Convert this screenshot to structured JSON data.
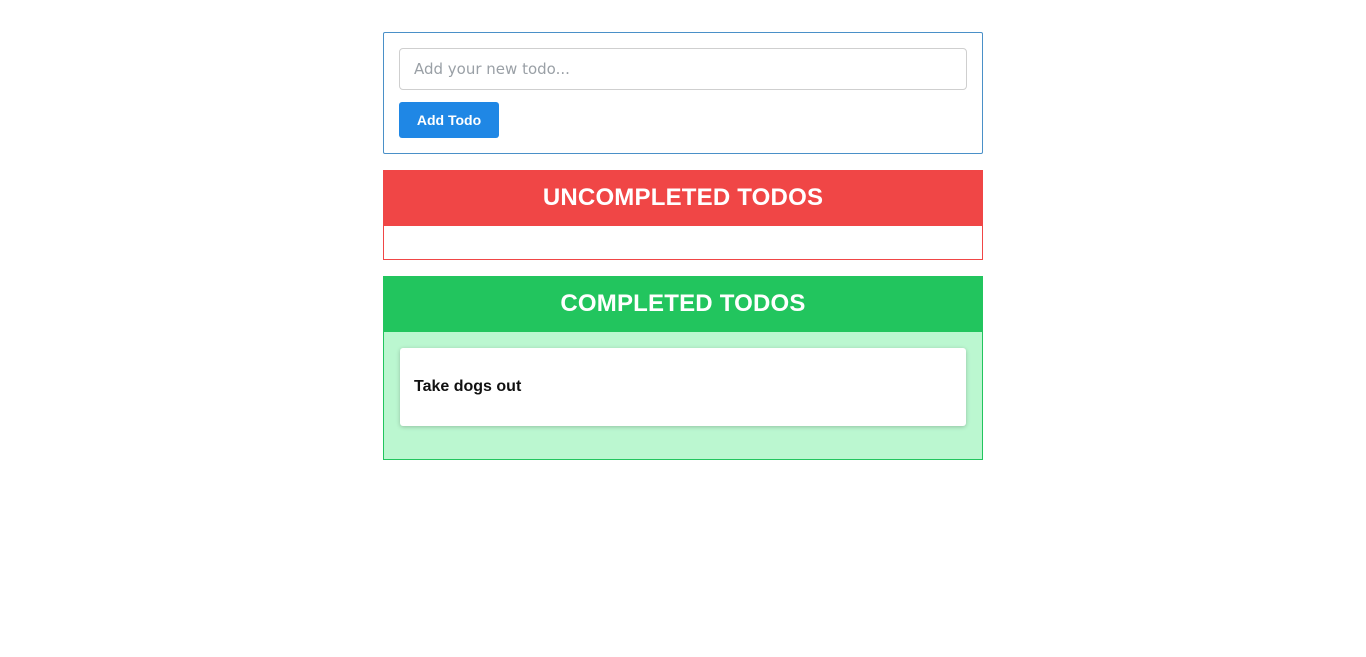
{
  "form": {
    "input_value": "",
    "input_placeholder": "Add your new todo...",
    "add_button_label": "Add Todo"
  },
  "uncompleted": {
    "title": "UNCOMPLETED TODOS",
    "items": []
  },
  "completed": {
    "title": "COMPLETED TODOS",
    "items": [
      {
        "text": "Take dogs out"
      }
    ]
  },
  "colors": {
    "accent_blue": "#1f87e5",
    "uncompleted_red": "#f04646",
    "completed_green": "#22c55e",
    "completed_bg": "#bbf7d0"
  }
}
